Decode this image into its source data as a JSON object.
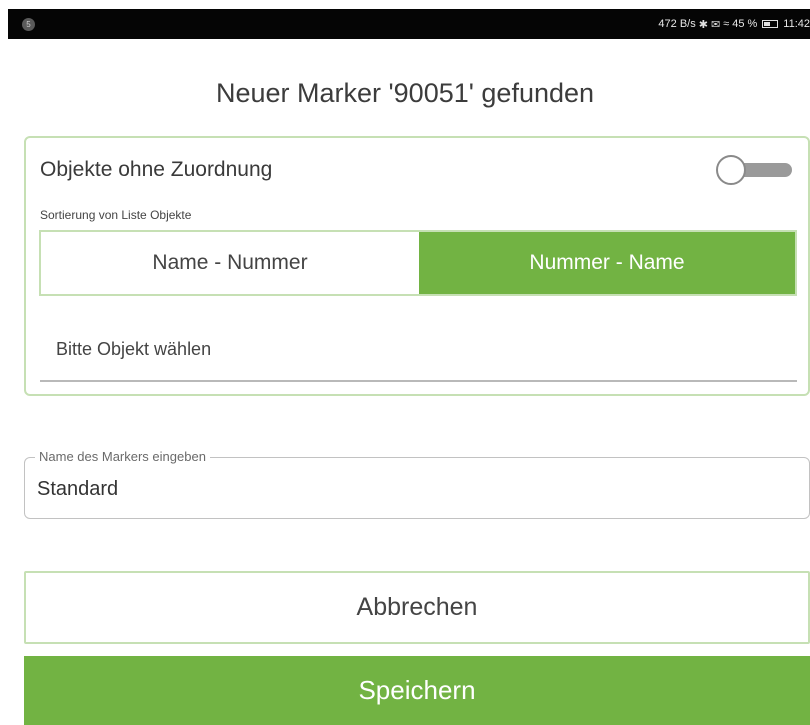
{
  "status_bar": {
    "notification_count": "5",
    "network_speed": "472 B/s",
    "bluetooth_icon": "✱",
    "signal_icon": "✉",
    "wifi_icon": "≈",
    "battery_percent": "45 %",
    "time": "11:42"
  },
  "dialog": {
    "title": "Neuer Marker '90051' gefunden"
  },
  "objects": {
    "toggle_label": "Objekte ohne Zuordnung",
    "toggle_on": false,
    "sort_label": "Sortierung von Liste Objekte",
    "sort_options": [
      "Name - Nummer",
      "Nummer - Name"
    ],
    "sort_selected": "Nummer - Name",
    "select_placeholder": "Bitte Objekt wählen"
  },
  "marker_name": {
    "label": "Name des Markers eingeben",
    "value": "Standard"
  },
  "actions": {
    "cancel_label": "Abbrechen",
    "save_label": "Speichern"
  },
  "colors": {
    "accent": "#72b343",
    "accent_border": "#c6e0b4",
    "status_bar": "#050505"
  }
}
